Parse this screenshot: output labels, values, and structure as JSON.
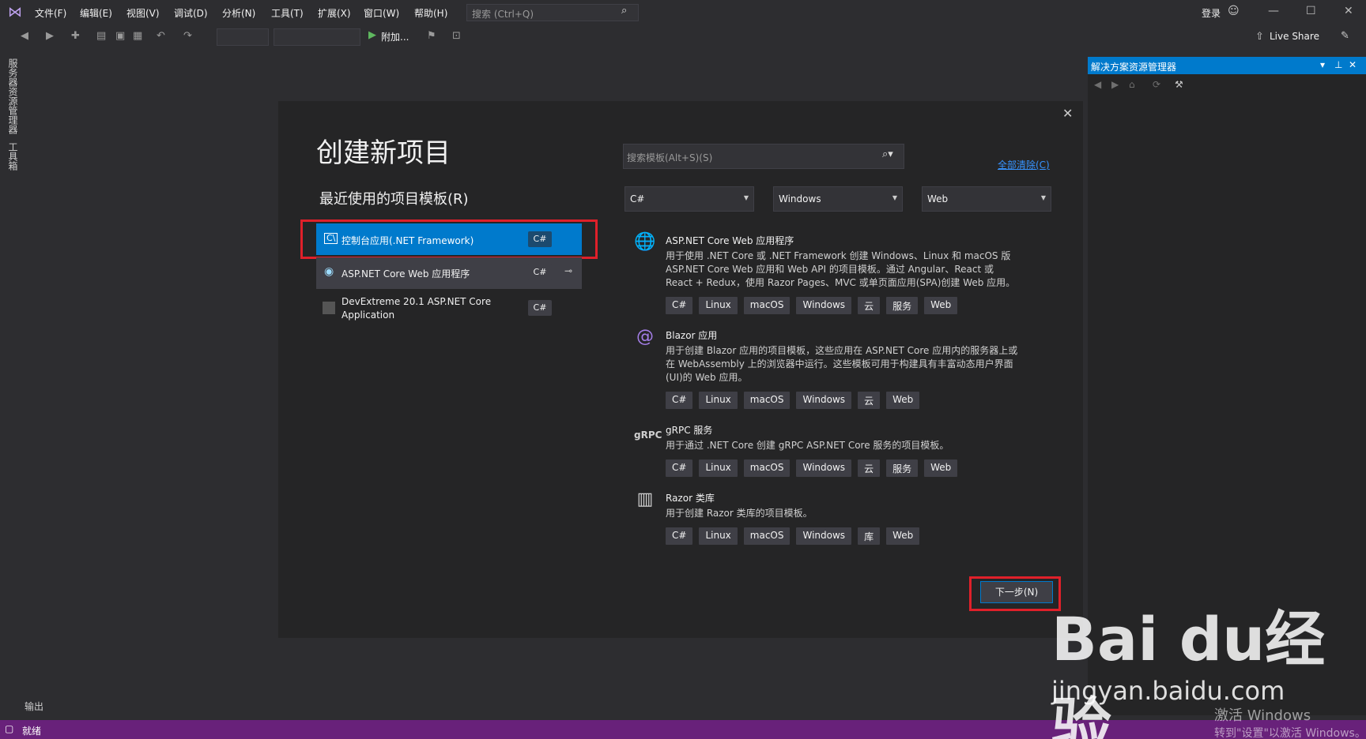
{
  "menu": [
    "文件(F)",
    "编辑(E)",
    "视图(V)",
    "调试(D)",
    "分析(N)",
    "工具(T)",
    "扩展(X)",
    "窗口(W)",
    "帮助(H)"
  ],
  "search_placeholder": "搜索 (Ctrl+Q)",
  "login": "登录",
  "toolbar": {
    "attach": "附加...",
    "live_share": "Live Share"
  },
  "left_tabs": [
    "服务器资源管理器",
    "工具箱"
  ],
  "dialog": {
    "title": "创建新项目",
    "recent_heading": "最近使用的项目模板(R)",
    "recent": [
      {
        "label": "控制台应用(.NET Framework)",
        "lang": "C#",
        "selected": true
      },
      {
        "label": "ASP.NET Core Web 应用程序",
        "lang": "C#"
      },
      {
        "label": "DevExtreme 20.1 ASP.NET Core Application",
        "lang": "C#"
      }
    ],
    "template_search_placeholder": "搜索模板(Alt+S)(S)",
    "clear_all": "全部清除(C)",
    "filters": [
      "C#",
      "Windows",
      "Web"
    ],
    "templates": [
      {
        "icon": "globe-icon",
        "title": "ASP.NET Core Web 应用程序",
        "desc": "用于使用 .NET Core 或 .NET Framework 创建 Windows、Linux 和 macOS 版 ASP.NET Core Web 应用和 Web API 的项目模板。通过 Angular、React 或 React + Redux，使用 Razor Pages、MVC 或单页面应用(SPA)创建 Web 应用。",
        "tags": [
          "C#",
          "Linux",
          "macOS",
          "Windows",
          "云",
          "服务",
          "Web"
        ]
      },
      {
        "icon": "blazor-icon",
        "title": "Blazor 应用",
        "desc": "用于创建 Blazor 应用的项目模板，这些应用在 ASP.NET Core 应用内的服务器上或在 WebAssembly 上的浏览器中运行。这些模板可用于构建具有丰富动态用户界面(UI)的 Web 应用。",
        "tags": [
          "C#",
          "Linux",
          "macOS",
          "Windows",
          "云",
          "Web"
        ]
      },
      {
        "icon": "grpc-icon",
        "icon_text": "gRPC",
        "title": "gRPC 服务",
        "desc": "用于通过 .NET Core 创建 gRPC ASP.NET Core 服务的项目模板。",
        "tags": [
          "C#",
          "Linux",
          "macOS",
          "Windows",
          "云",
          "服务",
          "Web"
        ]
      },
      {
        "icon": "razor-library-icon",
        "title": "Razor 类库",
        "desc": "用于创建 Razor 类库的项目模板。",
        "tags": [
          "C#",
          "Linux",
          "macOS",
          "Windows",
          "库",
          "Web"
        ]
      }
    ],
    "next_button": "下一步(N)"
  },
  "solution_explorer": {
    "title": "解决方案资源管理器"
  },
  "output_tab": "输出",
  "status": "就绪",
  "watermark": {
    "brand": "Bai du经验",
    "url": "jingyan.baidu.com",
    "activate_title": "激活 Windows",
    "activate_sub": "转到\"设置\"以激活 Windows。"
  },
  "colors": {
    "accent": "#007acc",
    "status_bar": "#68217a",
    "highlight_box": "#e0202a"
  }
}
